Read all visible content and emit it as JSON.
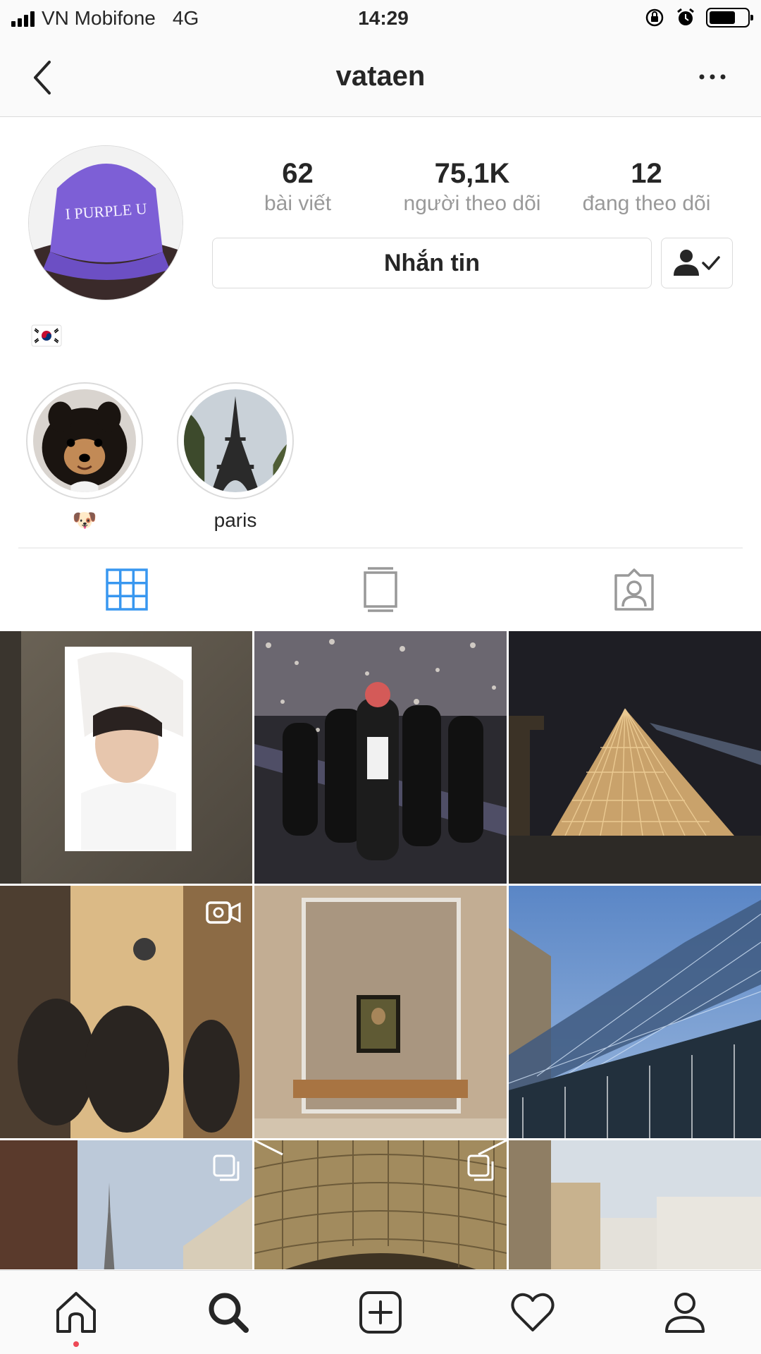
{
  "status_bar": {
    "carrier": "VN Mobifone",
    "network": "4G",
    "time": "14:29",
    "battery_percent": 70,
    "icons": [
      "signal-icon",
      "orientation-lock-icon",
      "alarm-icon",
      "battery-icon"
    ]
  },
  "nav": {
    "title": "vataen",
    "icons": [
      "back-chevron-icon",
      "more-dots-icon"
    ]
  },
  "profile": {
    "avatar_text": "I PURPLE U",
    "stats": [
      {
        "num": "62",
        "label": "bài viết"
      },
      {
        "num": "75,1K",
        "label": "người theo dõi"
      },
      {
        "num": "12",
        "label": "đang theo dõi"
      }
    ],
    "message_button": "Nhắn tin",
    "follow_icon": "person-check-icon",
    "bio_icon": "korea-flag-icon"
  },
  "highlights": [
    {
      "label": "🐶",
      "icon": "dog-face-icon"
    },
    {
      "label": "paris",
      "icon": "eiffel-tower-image"
    }
  ],
  "tabs": [
    {
      "name": "grid",
      "icon": "grid-icon",
      "active": true
    },
    {
      "name": "igtv",
      "icon": "tv-icon",
      "active": false
    },
    {
      "name": "tagged",
      "icon": "tagged-person-icon",
      "active": false
    }
  ],
  "colors": {
    "active_tab": "#3897f0",
    "inactive": "#999999",
    "notification_dot": "#ed4956",
    "border": "#dbdbdb"
  },
  "bottom_bar": [
    {
      "name": "home",
      "icon": "home-icon"
    },
    {
      "name": "search",
      "icon": "search-icon",
      "active": true
    },
    {
      "name": "new-post",
      "icon": "add-post-icon"
    },
    {
      "name": "activity",
      "icon": "heart-icon"
    },
    {
      "name": "profile",
      "icon": "profile-icon"
    }
  ]
}
